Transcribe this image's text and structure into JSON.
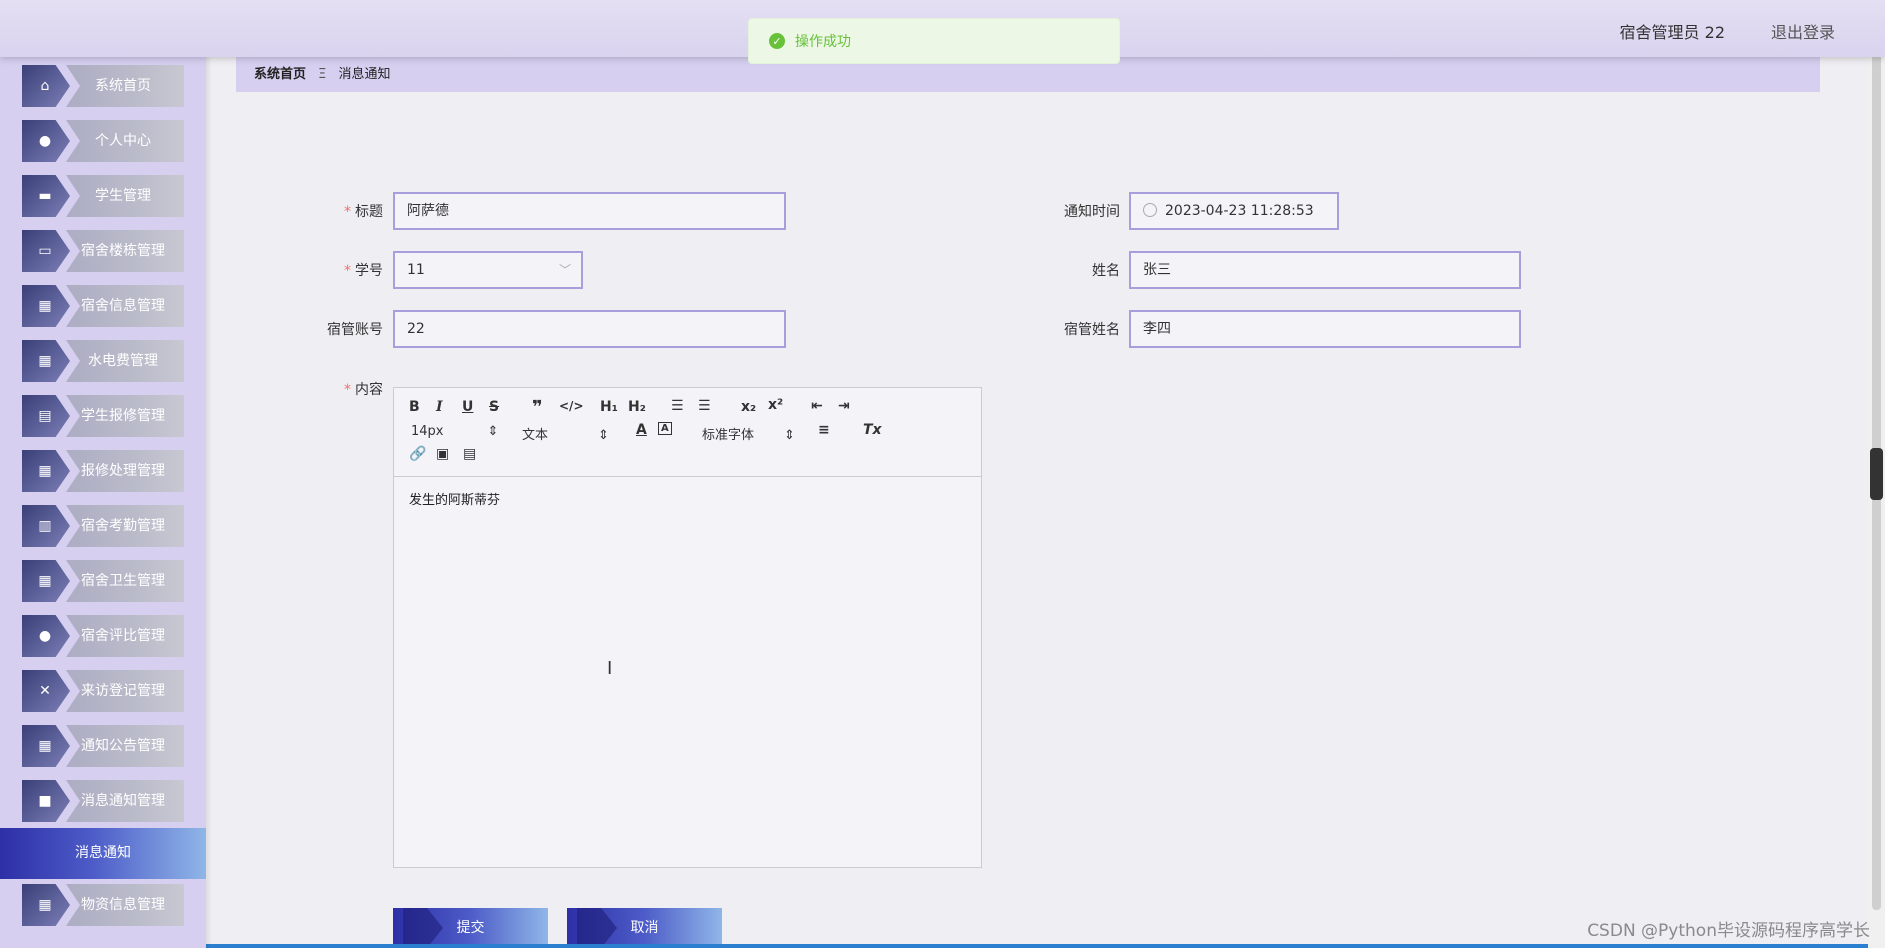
{
  "header": {
    "user_label": "宿舍管理员 22",
    "logout_label": "退出登录"
  },
  "toast": {
    "message": "操作成功"
  },
  "sidebar": {
    "items": [
      {
        "label": "系统首页",
        "icon": "home-icon"
      },
      {
        "label": "个人中心",
        "icon": "user-icon"
      },
      {
        "label": "学生管理",
        "icon": "student-icon"
      },
      {
        "label": "宿舍楼栋管理",
        "icon": "monitor-icon"
      },
      {
        "label": "宿舍信息管理",
        "icon": "grid-icon"
      },
      {
        "label": "水电费管理",
        "icon": "grid-icon"
      },
      {
        "label": "学生报修管理",
        "icon": "clipboard-icon"
      },
      {
        "label": "报修处理管理",
        "icon": "grid-icon"
      },
      {
        "label": "宿舍考勤管理",
        "icon": "book-icon"
      },
      {
        "label": "宿舍卫生管理",
        "icon": "grid-icon"
      },
      {
        "label": "宿舍评比管理",
        "icon": "user-icon"
      },
      {
        "label": "来访登记管理",
        "icon": "ticket-icon"
      },
      {
        "label": "通知公告管理",
        "icon": "grid-icon"
      },
      {
        "label": "消息通知管理",
        "icon": "chat-icon"
      }
    ],
    "active_item": "消息通知",
    "last_item": {
      "label": "物资信息管理",
      "icon": "grid-icon"
    }
  },
  "breadcrumb": {
    "home": "系统首页",
    "separator": "Ξ",
    "current": "消息通知"
  },
  "form": {
    "title_label": "标题",
    "title_value": "阿萨德",
    "time_label": "通知时间",
    "time_value": "2023-04-23 11:28:53",
    "student_no_label": "学号",
    "student_no_value": "11",
    "name_label": "姓名",
    "name_value": "张三",
    "manager_account_label": "宿管账号",
    "manager_account_value": "22",
    "manager_name_label": "宿管姓名",
    "manager_name_value": "李四",
    "content_label": "内容",
    "content_value": "发生的阿斯蒂芬"
  },
  "editor": {
    "size_value": "14px",
    "format_value": "文本",
    "font_value": "标准字体"
  },
  "buttons": {
    "submit": "提交",
    "cancel": "取消"
  },
  "watermark": "CSDN @Python毕设源码程序高学长"
}
